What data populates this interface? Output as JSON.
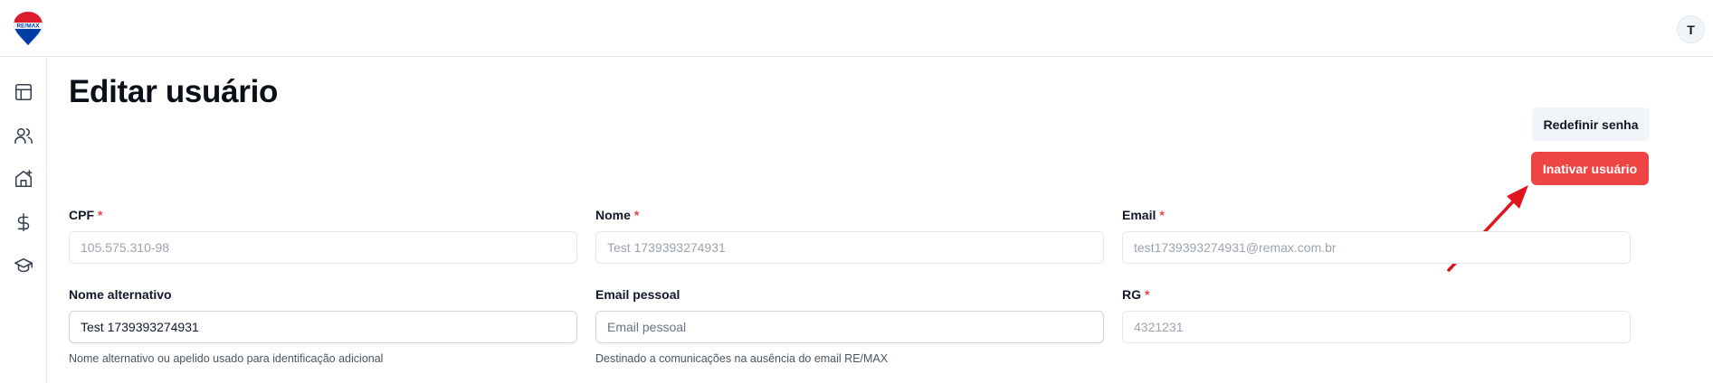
{
  "header": {
    "logo_text": "RE/MAX",
    "avatar_initial": "T"
  },
  "sidebar": {
    "items": [
      {
        "name": "dashboard",
        "icon": "layout-icon"
      },
      {
        "name": "users",
        "icon": "users-icon"
      },
      {
        "name": "properties",
        "icon": "house-plus-icon"
      },
      {
        "name": "finance",
        "icon": "dollar-icon"
      },
      {
        "name": "training",
        "icon": "graduation-cap-icon"
      }
    ]
  },
  "page": {
    "title": "Editar usuário"
  },
  "actions": {
    "reset_password": "Redefinir senha",
    "deactivate_user": "Inativar usuário"
  },
  "form": {
    "cpf": {
      "label": "CPF",
      "required": "*",
      "value": "105.575.310-98"
    },
    "nome": {
      "label": "Nome",
      "required": "*",
      "value": "Test 1739393274931"
    },
    "email": {
      "label": "Email",
      "required": "*",
      "value": "test1739393274931@remax.com.br"
    },
    "nome_alternativo": {
      "label": "Nome alternativo",
      "value": "Test 1739393274931",
      "help": "Nome alternativo ou apelido usado para identificação adicional"
    },
    "email_pessoal": {
      "label": "Email pessoal",
      "placeholder": "Email pessoal",
      "help": "Destinado a comunicações na ausência do email RE/MAX"
    },
    "rg": {
      "label": "RG",
      "required": "*",
      "value": "4321231"
    }
  },
  "colors": {
    "danger": "#ef4444",
    "annotation_arrow": "#e0141b"
  }
}
